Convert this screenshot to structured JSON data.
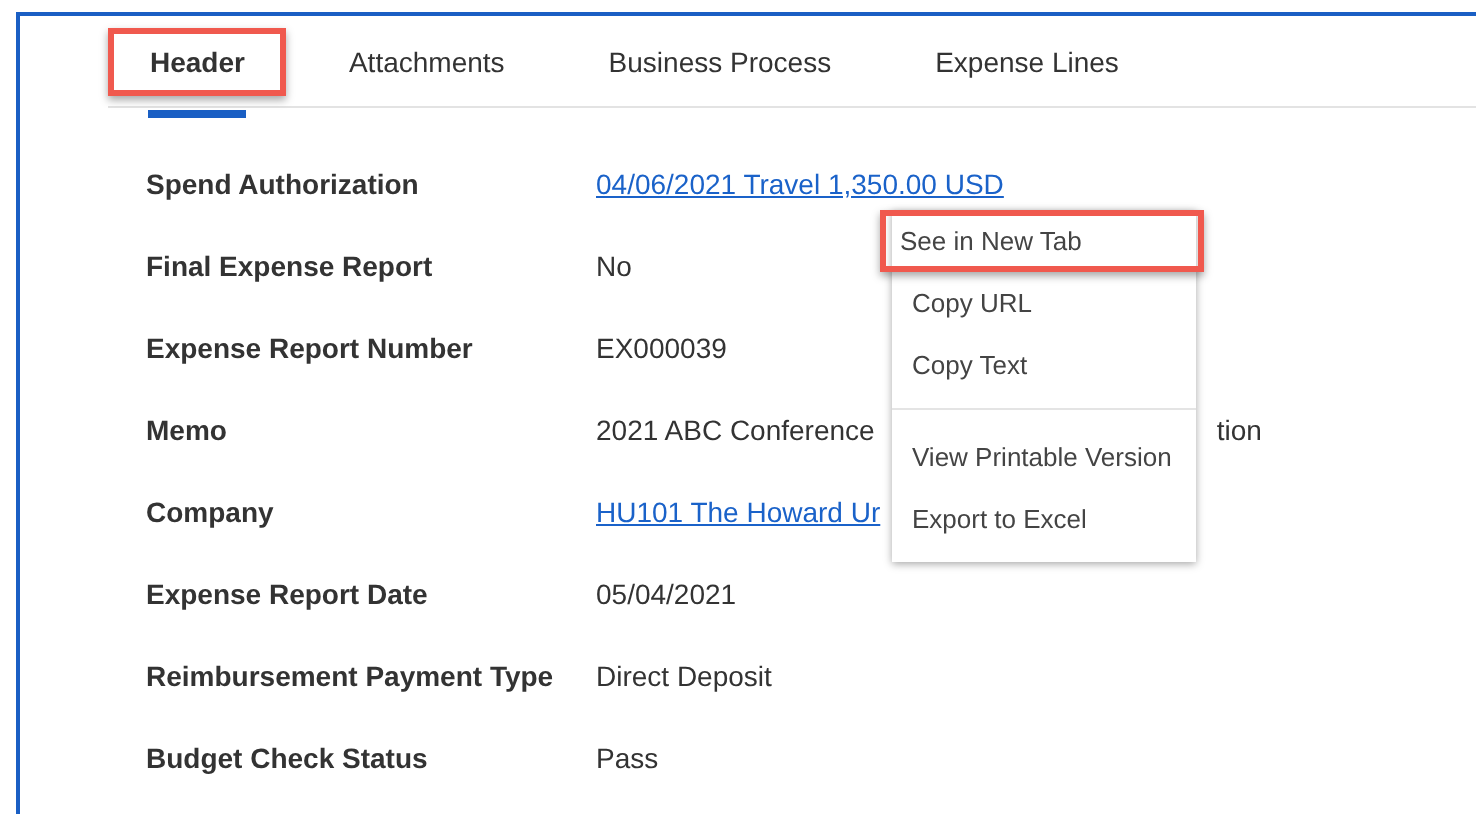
{
  "tabs": [
    {
      "label": "Header",
      "selected": true,
      "annotated": true
    },
    {
      "label": "Attachments",
      "selected": false,
      "annotated": false
    },
    {
      "label": "Business Process",
      "selected": false,
      "annotated": false
    },
    {
      "label": "Expense Lines",
      "selected": false,
      "annotated": false
    }
  ],
  "fields": [
    {
      "label": "Spend Authorization",
      "kind": "link",
      "value": [
        "04/06/2021 Travel 1,350.00 USD"
      ]
    },
    {
      "label": "Final Expense Report",
      "kind": "text",
      "value": [
        "No"
      ]
    },
    {
      "label": "Expense Report Number",
      "kind": "text",
      "value": [
        "EX000039"
      ]
    },
    {
      "label": "Memo",
      "kind": "text",
      "value": [
        "2021 ABC Conference",
        "tion"
      ]
    },
    {
      "label": "Company",
      "kind": "link",
      "value": [
        "HU101 The Howard Ur"
      ]
    },
    {
      "label": "Expense Report Date",
      "kind": "text",
      "value": [
        "05/04/2021"
      ]
    },
    {
      "label": "Reimbursement Payment Type",
      "kind": "text",
      "value": [
        "Direct Deposit"
      ]
    },
    {
      "label": "Budget Check Status",
      "kind": "text",
      "value": [
        "Pass"
      ]
    }
  ],
  "context_menu": {
    "groups": [
      [
        {
          "label": "See in New Tab",
          "annotated": true
        },
        {
          "label": "Copy URL",
          "annotated": false
        },
        {
          "label": "Copy Text",
          "annotated": false
        }
      ],
      [
        {
          "label": "View Printable Version",
          "annotated": false
        },
        {
          "label": "Export to Excel",
          "annotated": false
        }
      ]
    ]
  }
}
